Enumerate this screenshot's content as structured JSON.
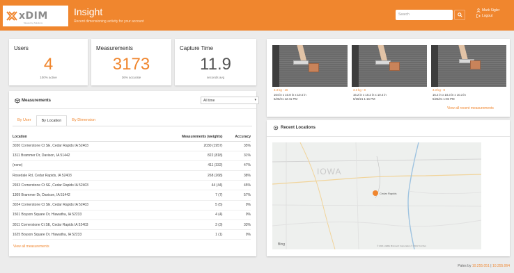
{
  "header": {
    "brand": "xDIM",
    "brand_sub": "Measuring Solutions",
    "title": "Insight",
    "subtitle": "Recent dimensioning activity for your account",
    "search_placeholder": "Search",
    "user_name": "Mark Sigler",
    "logout_label": "Logout",
    "accent_color": "#f0862e"
  },
  "stats": {
    "users": {
      "title": "Users",
      "value": "4",
      "caption": "100% active"
    },
    "measurements": {
      "title": "Measurements",
      "value": "3173",
      "caption": "36% accurate"
    },
    "capture_time": {
      "title": "Capture Time",
      "value": "11.9",
      "caption": "seconds avg"
    }
  },
  "measurements_panel": {
    "title": "Measurements",
    "filter_value": "All time",
    "tabs": [
      "By User",
      "By Location",
      "By Dimension"
    ],
    "active_tab": "By Location",
    "columns": [
      "Location",
      "Measurements (weights)",
      "Accuracy"
    ],
    "rows": [
      [
        "3030 Cornerstone Ct SE, Cedar Rapids IA 52403",
        "2030 (1957)",
        "35%"
      ],
      [
        "1311 Brammer Dr, Davison, IA 51442",
        "822 (818)",
        "31%"
      ],
      [
        "(none)",
        "411 (332)",
        "47%"
      ],
      [
        "Rosedale Rd, Cedar Rapids, IA 52403",
        "268 (268)",
        "38%"
      ],
      [
        "2933 Cornerstone Ct SE, Cedar Rapids IA 52403",
        "44 (44)",
        "45%"
      ],
      [
        "1309 Brammer Dr, Davison, IA 51442",
        "7 (7)",
        "57%"
      ],
      [
        "3024 Cornerstone Ct SE, Cedar Rapids IA 52403",
        "5 (5)",
        "0%"
      ],
      [
        "1501 Boyson Square Dr, Hiawatha, IA 52233",
        "4 (4)",
        "0%"
      ],
      [
        "3011 Cornerstone Ct SE, Cedar Rapids IA 52403",
        "3 (3)",
        "33%"
      ],
      [
        "1625 Boyson Square Dr, Hiawatha, IA 52233",
        "1 (1)",
        "0%"
      ]
    ],
    "view_all": "View all measurements"
  },
  "recent_measurements": {
    "items": [
      {
        "line1": "3.3 kg  - 16",
        "line2": "164 in x 10.8 in x 10.4 in",
        "line3": "5/26/21 12:41 PM"
      },
      {
        "line1": "3.3 kg  - 8",
        "line2": "16.2 in x 10.2 in x 10.4 in",
        "line3": "5/26/21 1:16 PM"
      },
      {
        "line1": "3.3 kg  - 8",
        "line2": "16.2 in x 10.3 in x 10.3 in",
        "line3": "5/26/21 1:06 PM"
      }
    ],
    "view_all": "View all recent measurements"
  },
  "recent_locations": {
    "title": "Recent Locations",
    "map_state_label": "IOWA",
    "marker_label": "Cedar Rapids",
    "map_footer": "© 2021 HERE Microsoft Corporation  © 2021 TomTom",
    "map_brand": "Bing"
  },
  "footer": {
    "prefix": "Pales by",
    "link1": "10.255.051",
    "separator": "|",
    "link2": "10.355.064"
  }
}
